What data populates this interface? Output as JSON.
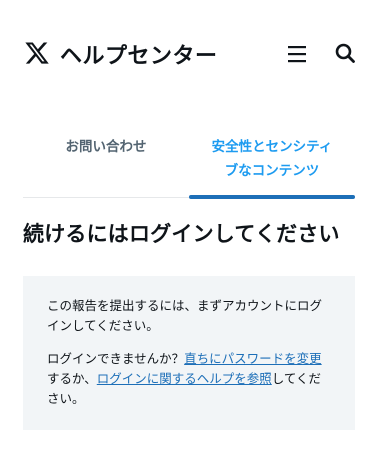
{
  "header": {
    "logo_icon": "x-logo-icon",
    "title": "ヘルプセンター",
    "menu_icon": "hamburger-menu-icon",
    "search_icon": "search-icon"
  },
  "tabs": [
    {
      "label": "お問い合わせ",
      "active": false
    },
    {
      "label_lines": [
        "安全性とセンシティ",
        "ブなコンテンツ"
      ],
      "active": true
    }
  ],
  "main": {
    "heading": "続けるにはログインしてください",
    "notice": {
      "paragraph1": "この報告を提出するには、まずアカウントにログインしてください。",
      "paragraph2_prefix": "ログインできませんか？",
      "link_reset_password": "直ちにパスワードを変更",
      "paragraph2_middle": "するか、",
      "link_login_help": "ログインに関するヘルプを参照",
      "paragraph2_suffix": "してください。"
    }
  },
  "colors": {
    "accent": "#1d9bf0",
    "link": "#1d6fb8",
    "text": "#0f1419",
    "muted": "#536471",
    "notice_bg": "#f2f5f7"
  }
}
